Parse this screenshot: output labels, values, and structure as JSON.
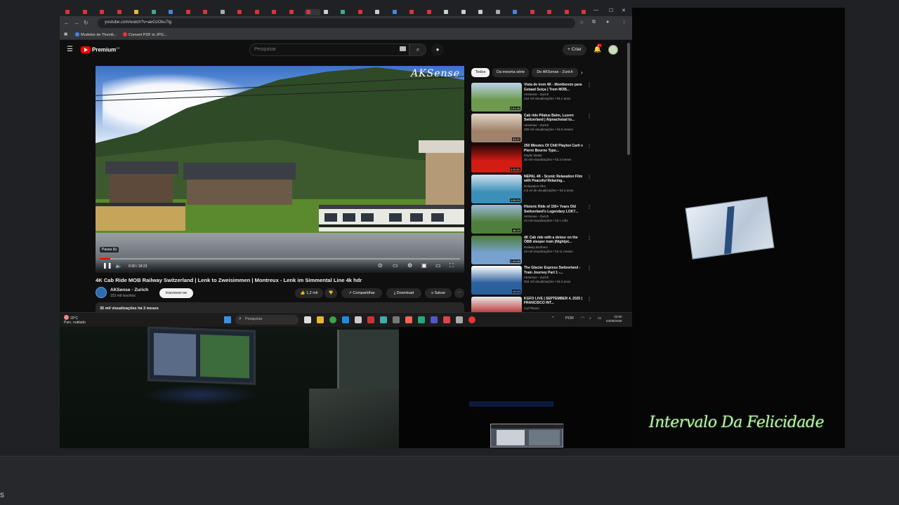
{
  "browser": {
    "tabs": [
      "",
      "",
      "",
      "",
      "",
      "",
      "",
      "",
      "",
      "",
      "",
      "",
      "",
      "",
      "",
      "",
      "",
      "",
      "",
      "",
      "",
      "",
      "",
      "",
      "",
      "",
      "",
      "",
      "",
      "",
      ""
    ],
    "url": "youtube.com/watch?v=aeGzOku7tg",
    "bookmarks": [
      "Modelos de Thumb...",
      "Convert PDF to JPG..."
    ]
  },
  "youtube": {
    "brand": "Premium",
    "search_placeholder": "Pesquisar",
    "create_label": "+ Criar",
    "notif_count": "9+"
  },
  "player": {
    "watermark": "AKSense",
    "pause_tooltip": "Pausa (k)",
    "time": "0:30 / 18:23",
    "progress": 0.03
  },
  "video": {
    "title": "4K Cab Ride MOB Railway Switzerland | Lenk to Zweisimmen | Montreux - Lenk im Simmental Line 4k hdr",
    "channel": "AKSense - Zurich",
    "subscribers": "153 mil inscritos",
    "subscribe_label": "Inscrever-se",
    "likes": "1,2 mil",
    "share_label": "Compartilhar",
    "download_label": "Download",
    "save_label": "Salvar",
    "description_meta": "35 mil visualizações há 3 meses"
  },
  "chips": [
    "Todos",
    "Da mesma série",
    "De AKSense - Zurich"
  ],
  "related": [
    {
      "title": "Vista de trem 4K - Montbovon para Gstaad Suíça | Trem MOB...",
      "channel": "AKSense - Zurich",
      "meta": "244 mil visualizações • há 2 anos",
      "duration": "2:01:46",
      "colors": [
        "#6d9a4e",
        "#bcd3ea"
      ]
    },
    {
      "title": "Cab ride Pilatus Bahn, Luzern Switzerland | Alpnachstad to...",
      "channel": "AKSense - Zurich",
      "meta": "409 mil visualizações • há 8 meses",
      "duration": "33:37",
      "colors": [
        "#a0826b",
        "#e2d7c8"
      ]
    },
    {
      "title": "250 Minutes Of Chill Playboi Carti x Pierre Bourne Type...",
      "channel": "Kaylor Beats",
      "meta": "32 mil visualizações • há 3 meses",
      "duration": "4:10:51",
      "colors": [
        "#d41c14",
        "#1a0505"
      ]
    },
    {
      "title": "NEPAL 4K - Scenic Relaxation Film with Peaceful Relaxing...",
      "channel": "Relaxation Film",
      "meta": "4,5 mi de visualizações • há 3 anos",
      "duration": "3:05:20",
      "colors": [
        "#3c8fb8",
        "#d2e3ee"
      ]
    },
    {
      "title": "Historic Ride of 150+ Years Old Switzerland's Legendary LOK7...",
      "channel": "AKSense - Zurich",
      "meta": "42 mil visualizações • há 1 mês",
      "duration": "48:29",
      "colors": [
        "#4f7f3c",
        "#9bbbd9"
      ]
    },
    {
      "title": "4K Cab ride with a detour on the ÖBB sleeper train (Nightjet...",
      "channel": "Railway Brothers",
      "meta": "23 mil visualizações • há 11 meses",
      "duration": "1:24:28",
      "colors": [
        "#77a2cf",
        "#4f7d3a"
      ]
    },
    {
      "title": "The Glacier Express Switzerland - Train Journey Part 1 -...",
      "channel": "AKSense - Zurich",
      "meta": "504 mil visualizações • há 3 anos",
      "duration": "42:03",
      "colors": [
        "#2c5f9e",
        "#ffffff"
      ]
    },
    {
      "title": "KGFO LIVE | SEPTEMBER 4, 2025 | FRANCISCO INT...",
      "channel": "Cal Planes",
      "meta": "",
      "duration": "",
      "colors": [
        "#b72b2b",
        "#eaeaea"
      ]
    }
  ],
  "taskbar": {
    "weather_temp": "20°C",
    "weather_desc": "Parc. nublado",
    "search_label": "Pesquisar",
    "lang": "POR",
    "time": "22:50",
    "date": "04/09/2025"
  },
  "overlay": {
    "caption": "Intervalo Da Felicidade"
  },
  "colors": {
    "accent": "#ff0000",
    "caption": "#b9f5a8"
  }
}
